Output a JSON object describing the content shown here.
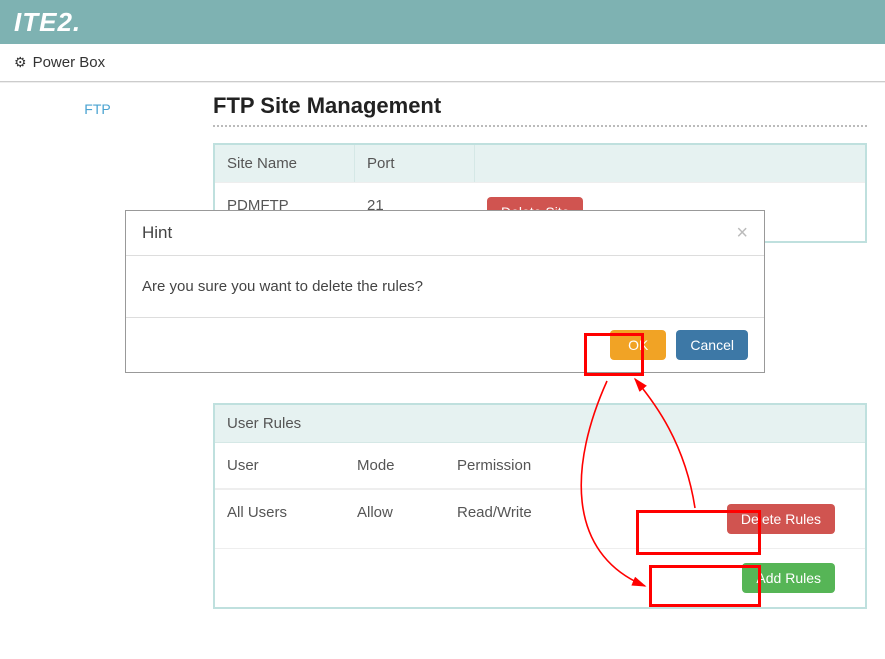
{
  "header": {
    "logo": "ITE2."
  },
  "breadcrumb": {
    "label": "Power Box"
  },
  "sidebar": {
    "items": [
      {
        "label": "FTP"
      }
    ]
  },
  "page": {
    "title": "FTP Site Management"
  },
  "sites_panel": {
    "col_name": "Site Name",
    "col_port": "Port",
    "rows": [
      {
        "name": "PDMFTP",
        "port": "21",
        "action": "Delete Site"
      }
    ]
  },
  "rules_panel": {
    "title": "User Rules",
    "col_user": "User",
    "col_mode": "Mode",
    "col_perm": "Permission",
    "rows": [
      {
        "user": "All Users",
        "mode": "Allow",
        "perm": "Read/Write",
        "delete": "Delete Rules"
      }
    ],
    "add": "Add Rules"
  },
  "dialog": {
    "title": "Hint",
    "message": "Are you sure you want to delete the rules?",
    "ok": "OK",
    "cancel": "Cancel"
  }
}
